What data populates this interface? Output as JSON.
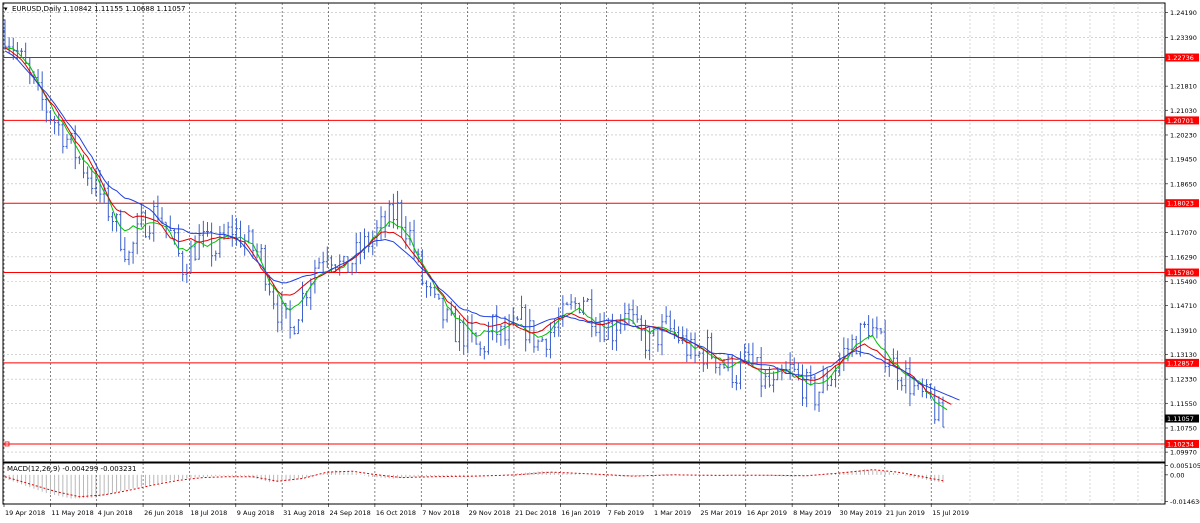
{
  "header": {
    "symbol": "EURUSD,Daily",
    "ohlc": "1.10842 1.11155 1.10688 1.11057",
    "macd_label": "MACD(12,26,9) -0.004299 -0.003231"
  },
  "colors": {
    "candle": "#3a5fcd",
    "ma_fast": "#00c000",
    "ma_mid": "#e00000",
    "ma_slow": "#1f3fe0",
    "hline": "#ff0000",
    "hist": "#b8b8b8",
    "signal": "#e00000",
    "grid": "#bbbbbb",
    "vgrid": "#333333"
  },
  "chart_data": [
    {
      "type": "candlestick",
      "title": "EURUSD,Daily 1.10842 1.11155 1.10688 1.11057",
      "y_ticks": [
        "1.24190",
        "1.23390",
        "1.21810",
        "1.21030",
        "1.20230",
        "1.19450",
        "1.18650",
        "1.17070",
        "1.16290",
        "1.15490",
        "1.14710",
        "1.13910",
        "1.13130",
        "1.12330",
        "1.11550",
        "1.10750",
        "1.09970"
      ],
      "ylim": [
        1.0965,
        1.245
      ],
      "x_ticks": [
        "19 Apr 2018",
        "11 May 2018",
        "4 Jun 2018",
        "26 Jun 2018",
        "18 Jul 2018",
        "9 Aug 2018",
        "31 Aug 2018",
        "24 Sep 2018",
        "16 Oct 2018",
        "7 Nov 2018",
        "29 Nov 2018",
        "21 Dec 2018",
        "16 Jan 2019",
        "7 Feb 2019",
        "1 Mar 2019",
        "25 Mar 2019",
        "16 Apr 2019",
        "8 May 2019",
        "30 May 2019",
        "21 Jun 2019",
        "15 Jul 2019"
      ],
      "levels": [
        {
          "label": "1.22736",
          "value": 1.22736
        },
        {
          "label": "1.20701",
          "value": 1.20701
        },
        {
          "label": "1.18023",
          "value": 1.18023
        },
        {
          "label": "1.15780",
          "value": 1.1578
        },
        {
          "label": "1.12857",
          "value": 1.12857
        },
        {
          "label": "1.10234",
          "value": 1.10234
        }
      ],
      "current_price": {
        "label": "1.11057",
        "value": 1.11057
      },
      "price_path": [
        [
          0,
          1.236
        ],
        [
          3,
          1.229
        ],
        [
          8,
          1.215
        ],
        [
          14,
          1.203
        ],
        [
          20,
          1.19
        ],
        [
          26,
          1.176
        ],
        [
          30,
          1.163
        ],
        [
          33,
          1.173
        ],
        [
          37,
          1.178
        ],
        [
          40,
          1.17
        ],
        [
          43,
          1.16
        ],
        [
          47,
          1.168
        ],
        [
          51,
          1.165
        ],
        [
          55,
          1.172
        ],
        [
          58,
          1.168
        ],
        [
          62,
          1.163
        ],
        [
          66,
          1.146
        ],
        [
          69,
          1.139
        ],
        [
          72,
          1.15
        ],
        [
          75,
          1.16
        ],
        [
          78,
          1.166
        ],
        [
          82,
          1.158
        ],
        [
          86,
          1.165
        ],
        [
          91,
          1.172
        ],
        [
          95,
          1.178
        ],
        [
          98,
          1.17
        ],
        [
          101,
          1.155
        ],
        [
          104,
          1.147
        ],
        [
          108,
          1.14
        ],
        [
          112,
          1.137
        ],
        [
          115,
          1.132
        ],
        [
          118,
          1.14
        ],
        [
          121,
          1.136
        ],
        [
          125,
          1.142
        ],
        [
          129,
          1.135
        ],
        [
          133,
          1.14
        ],
        [
          137,
          1.146
        ],
        [
          140,
          1.15
        ],
        [
          143,
          1.143
        ],
        [
          147,
          1.139
        ],
        [
          150,
          1.147
        ],
        [
          153,
          1.138
        ],
        [
          156,
          1.135
        ],
        [
          160,
          1.14
        ],
        [
          163,
          1.137
        ],
        [
          167,
          1.13
        ],
        [
          170,
          1.133
        ],
        [
          174,
          1.128
        ],
        [
          177,
          1.125
        ],
        [
          180,
          1.13
        ],
        [
          183,
          1.123
        ],
        [
          186,
          1.12
        ],
        [
          190,
          1.126
        ],
        [
          193,
          1.122
        ],
        [
          196,
          1.118
        ],
        [
          200,
          1.125
        ],
        [
          203,
          1.132
        ],
        [
          206,
          1.136
        ],
        [
          209,
          1.141
        ],
        [
          212,
          1.134
        ],
        [
          215,
          1.128
        ],
        [
          218,
          1.124
        ],
        [
          221,
          1.118
        ],
        [
          224,
          1.116
        ],
        [
          227,
          1.108
        ]
      ],
      "bars": 228
    },
    {
      "type": "macd",
      "title": "MACD(12,26,9) -0.004299 -0.003231",
      "y_ticks": [
        "0.005105",
        "0.00",
        "-0.014636"
      ],
      "ylim": [
        -0.016,
        0.0065
      ],
      "macd_path": [
        [
          0,
          -0.002
        ],
        [
          5,
          -0.006
        ],
        [
          10,
          -0.01
        ],
        [
          16,
          -0.013
        ],
        [
          22,
          -0.0125
        ],
        [
          28,
          -0.009
        ],
        [
          34,
          -0.006
        ],
        [
          40,
          -0.003
        ],
        [
          46,
          -0.0015
        ],
        [
          52,
          -0.0005
        ],
        [
          58,
          -0.0005
        ],
        [
          64,
          -0.004
        ],
        [
          70,
          -0.003
        ],
        [
          76,
          0.0
        ],
        [
          80,
          0.0025
        ],
        [
          84,
          0.0015
        ],
        [
          88,
          -0.001
        ],
        [
          94,
          -0.002
        ],
        [
          100,
          -0.001
        ],
        [
          110,
          -0.0005
        ],
        [
          120,
          0.0
        ],
        [
          130,
          0.002
        ],
        [
          140,
          0.0
        ],
        [
          150,
          -0.001
        ],
        [
          160,
          0.0005
        ],
        [
          170,
          -0.0005
        ],
        [
          180,
          0.0
        ],
        [
          190,
          -0.001
        ],
        [
          200,
          0.0005
        ],
        [
          208,
          0.003
        ],
        [
          214,
          0.0015
        ],
        [
          220,
          -0.0015
        ],
        [
          227,
          -0.0043
        ]
      ],
      "signal_path": [
        [
          0,
          -0.001
        ],
        [
          6,
          -0.005
        ],
        [
          12,
          -0.009
        ],
        [
          18,
          -0.012
        ],
        [
          24,
          -0.011
        ],
        [
          30,
          -0.0085
        ],
        [
          36,
          -0.0055
        ],
        [
          42,
          -0.003
        ],
        [
          48,
          -0.0015
        ],
        [
          54,
          -0.001
        ],
        [
          60,
          -0.001
        ],
        [
          66,
          -0.0035
        ],
        [
          72,
          -0.002
        ],
        [
          78,
          0.0015
        ],
        [
          84,
          0.002
        ],
        [
          90,
          0.0
        ],
        [
          96,
          -0.0015
        ],
        [
          104,
          -0.001
        ],
        [
          114,
          -0.0007
        ],
        [
          124,
          0.0
        ],
        [
          132,
          0.0015
        ],
        [
          142,
          0.0005
        ],
        [
          152,
          -0.0007
        ],
        [
          162,
          0.0
        ],
        [
          172,
          -0.0003
        ],
        [
          184,
          -0.0002
        ],
        [
          194,
          -0.0005
        ],
        [
          202,
          0.001
        ],
        [
          210,
          0.0028
        ],
        [
          216,
          0.0015
        ],
        [
          222,
          -0.001
        ],
        [
          227,
          -0.0032
        ]
      ]
    }
  ]
}
